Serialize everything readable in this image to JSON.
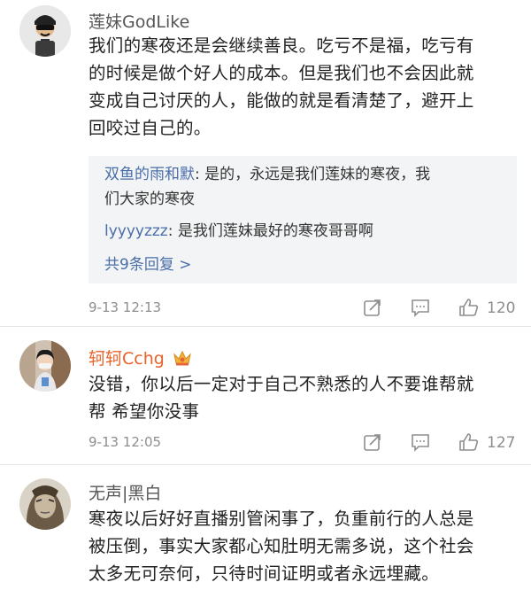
{
  "comments": [
    {
      "username": "莲妹GodLike",
      "lines": [
        "我们的寒夜还是会继续善良。吃亏不是福，吃亏有",
        "的时候是做个好人的成本。但是我们也不会因此就",
        "变成自己讨厌的人，能做的就是看清楚了，避开上",
        "回咬过自己的。"
      ],
      "replies": [
        {
          "user": "双鱼的雨和默",
          "sep": ":",
          "text1": " 是的，永远是我们莲妹的寒夜，我",
          "text2": "们大家的寒夜"
        },
        {
          "user": "lyyyyzzz",
          "sep": ":",
          "text1": " 是我们莲妹最好的寒夜哥哥啊"
        }
      ],
      "more_replies": "共9条回复 >",
      "time": "9-13 12:13",
      "likes": "120"
    },
    {
      "username": "轲轲Cchg",
      "lines": [
        "没错，你以后一定对于自己不熟悉的人不要谁帮就",
        "帮 希望你没事"
      ],
      "time": "9-13 12:05",
      "likes": "127"
    },
    {
      "username": "无声|黑白",
      "lines": [
        "寒夜以后好好直播别管闲事了，负重前行的人总是",
        "被压倒，事实大家都心知肚明无需多说，这个社会",
        "太多无可奈何，只待时间证明或者永远埋藏。"
      ]
    }
  ],
  "colors": {
    "username_default": "#555555",
    "username_vip": "#e8622a",
    "link_blue": "#4a6ea9",
    "meta_gray": "#8e8e8e",
    "reply_bg": "#f3f4f5"
  },
  "icons": [
    "forward-icon",
    "comment-icon",
    "like-icon",
    "crown-badge-icon"
  ]
}
